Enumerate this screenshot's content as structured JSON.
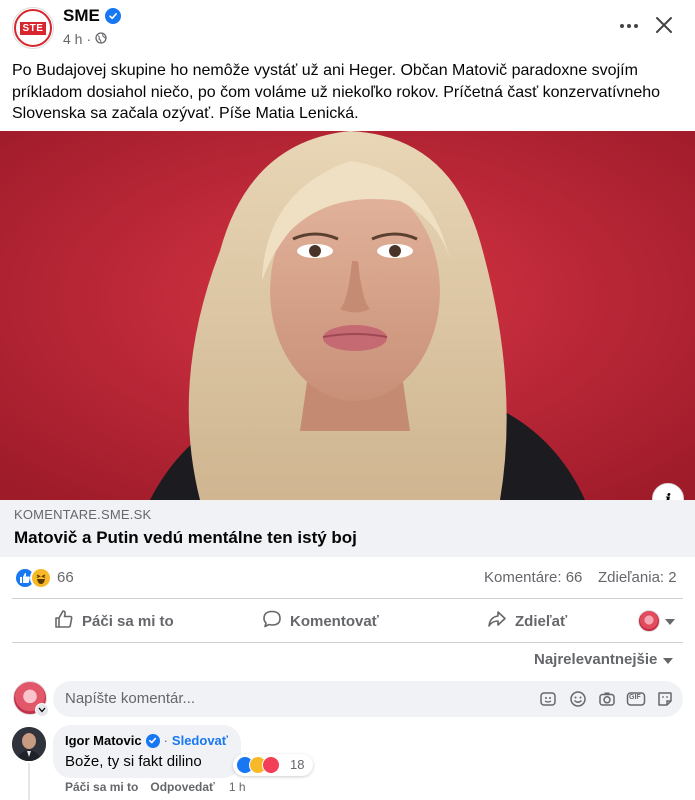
{
  "post": {
    "page_name": "SME",
    "logo_text": "STE",
    "time": "4 h",
    "dot": "·",
    "text": "Po Budajovej skupine ho nemôže vystáť už ani Heger. Občan Matovič paradoxne svojím príkladom dosiahol niečo, po čom voláme už niekoľko rokov. Príčetná časť konzervatívneho Slovenska sa začala ozývať. Píše Matia Lenická.",
    "icons": {
      "verified": "verified-badge-icon",
      "privacy": "globe-icon",
      "more": "more-icon",
      "close": "close-icon"
    }
  },
  "link": {
    "domain": "KOMENTARE.SME.SK",
    "title": "Matovič a Putin vedú mentálne ten istý boj",
    "info_glyph": "i"
  },
  "stats": {
    "reaction_count": "66",
    "comments": "Komentáre: 66",
    "shares": "Zdieľania: 2",
    "reactions": [
      "like",
      "haha"
    ]
  },
  "actions": {
    "like": "Páči sa mi to",
    "comment": "Komentovať",
    "share": "Zdieľať"
  },
  "sort": {
    "label": "Najrelevantnejšie"
  },
  "composer": {
    "placeholder": "Napíšte komentár...",
    "icons": [
      "sticker-icon",
      "emoji-icon",
      "camera-icon",
      "gif-icon",
      "sticker-alt-icon"
    ],
    "gif_label": "GIF"
  },
  "comment": {
    "author": "Igor Matovic",
    "separator": "·",
    "follow": "Sledovať",
    "text": "Bože, ty si fakt dilino",
    "reaction_count": "18",
    "reactions": [
      "like",
      "haha",
      "love"
    ],
    "like_action": "Páči sa mi to",
    "reply_action": "Odpovedať",
    "time": "1 h"
  },
  "colors": {
    "brand": "#1877f2",
    "text_secondary": "#65676b",
    "image_background": "#c8283a",
    "bubble": "#f0f2f5"
  }
}
